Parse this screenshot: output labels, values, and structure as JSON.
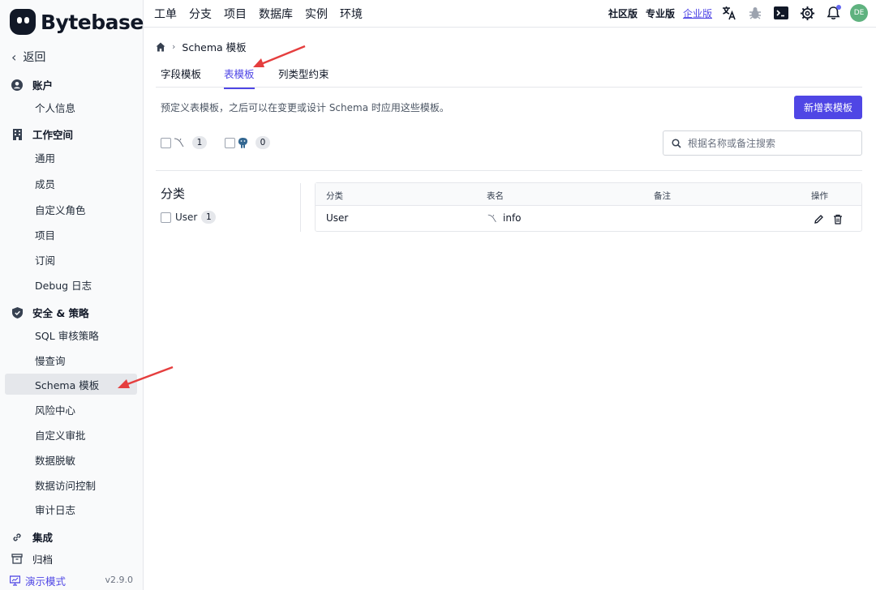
{
  "app": {
    "name": "Bytebase",
    "version": "v2.9.0"
  },
  "sidebar": {
    "back_label": "返回",
    "groups": [
      {
        "label": "账户",
        "items": [
          "个人信息"
        ]
      },
      {
        "label": "工作空间",
        "items": [
          "通用",
          "成员",
          "自定义角色",
          "项目",
          "订阅",
          "Debug 日志"
        ]
      },
      {
        "label": "安全 & 策略",
        "items": [
          "SQL 审核策略",
          "慢查询",
          "Schema 模板",
          "风险中心",
          "自定义审批",
          "数据脱敏",
          "数据访问控制",
          "审计日志"
        ]
      },
      {
        "label": "集成",
        "items": []
      },
      {
        "label": "归档",
        "items": []
      }
    ],
    "active_item": "Schema 模板",
    "demo_label": "演示模式"
  },
  "topbar": {
    "nav": [
      "工单",
      "分支",
      "项目",
      "数据库",
      "实例",
      "环境"
    ],
    "plans": [
      "社区版",
      "专业版",
      "企业版"
    ],
    "current_plan": "企业版",
    "avatar_initials": "DE"
  },
  "breadcrumb": {
    "current": "Schema 模板"
  },
  "tabs": [
    "字段模板",
    "表模板",
    "列类型约束"
  ],
  "active_tab": "表模板",
  "description": "预定义表模板，之后可以在变更或设计 Schema 时应用这些模板。",
  "add_button": "新增表模板",
  "filters": [
    {
      "engine": "mysql",
      "count": "1"
    },
    {
      "engine": "postgres",
      "count": "0"
    }
  ],
  "search": {
    "placeholder": "根据名称或备注搜索"
  },
  "category": {
    "title": "分类",
    "items": [
      {
        "label": "User",
        "count": "1"
      }
    ]
  },
  "table": {
    "headers": [
      "分类",
      "表名",
      "备注",
      "操作"
    ],
    "rows": [
      {
        "category": "User",
        "name": "info",
        "comment": ""
      }
    ]
  },
  "colors": {
    "accent": "#4f46e5",
    "annotation_arrow": "#e53e3e",
    "avatar": "#5fb27f"
  }
}
